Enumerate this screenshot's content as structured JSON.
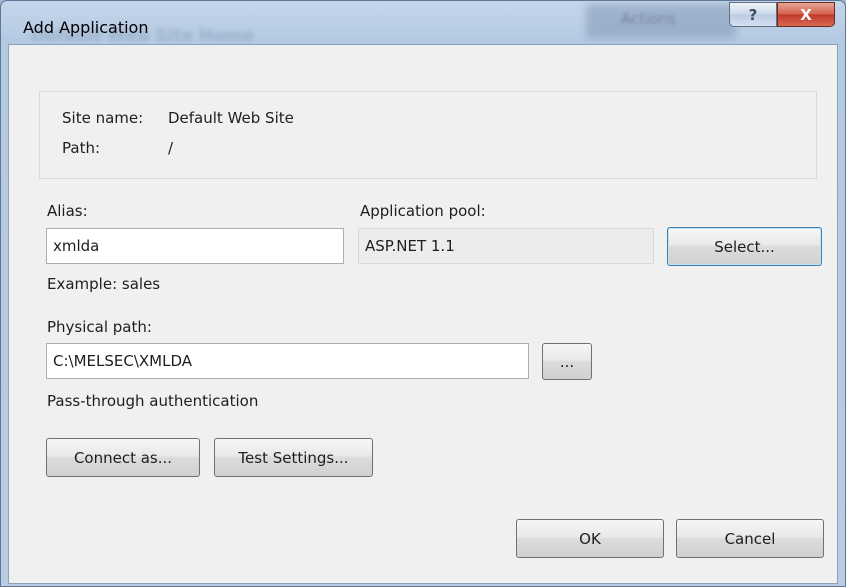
{
  "dialog": {
    "title": "Add Application",
    "help_glyph": "?",
    "close_glyph": "X"
  },
  "background": {
    "blurred_actions_label": "Actions",
    "blurred_header_text": "Default Web Site Home"
  },
  "info": {
    "site_name_label": "Site name:",
    "site_name_value": "Default Web Site",
    "path_label": "Path:",
    "path_value": "/"
  },
  "alias": {
    "label": "Alias:",
    "value": "xmlda",
    "example": "Example: sales"
  },
  "app_pool": {
    "label": "Application pool:",
    "value": "ASP.NET 1.1",
    "select_button": "Select..."
  },
  "physical_path": {
    "label": "Physical path:",
    "value": "C:\\MELSEC\\XMLDA",
    "browse_button": "..."
  },
  "auth": {
    "label": "Pass-through authentication",
    "connect_as_button": "Connect as...",
    "test_settings_button": "Test Settings..."
  },
  "footer": {
    "ok_button": "OK",
    "cancel_button": "Cancel"
  }
}
